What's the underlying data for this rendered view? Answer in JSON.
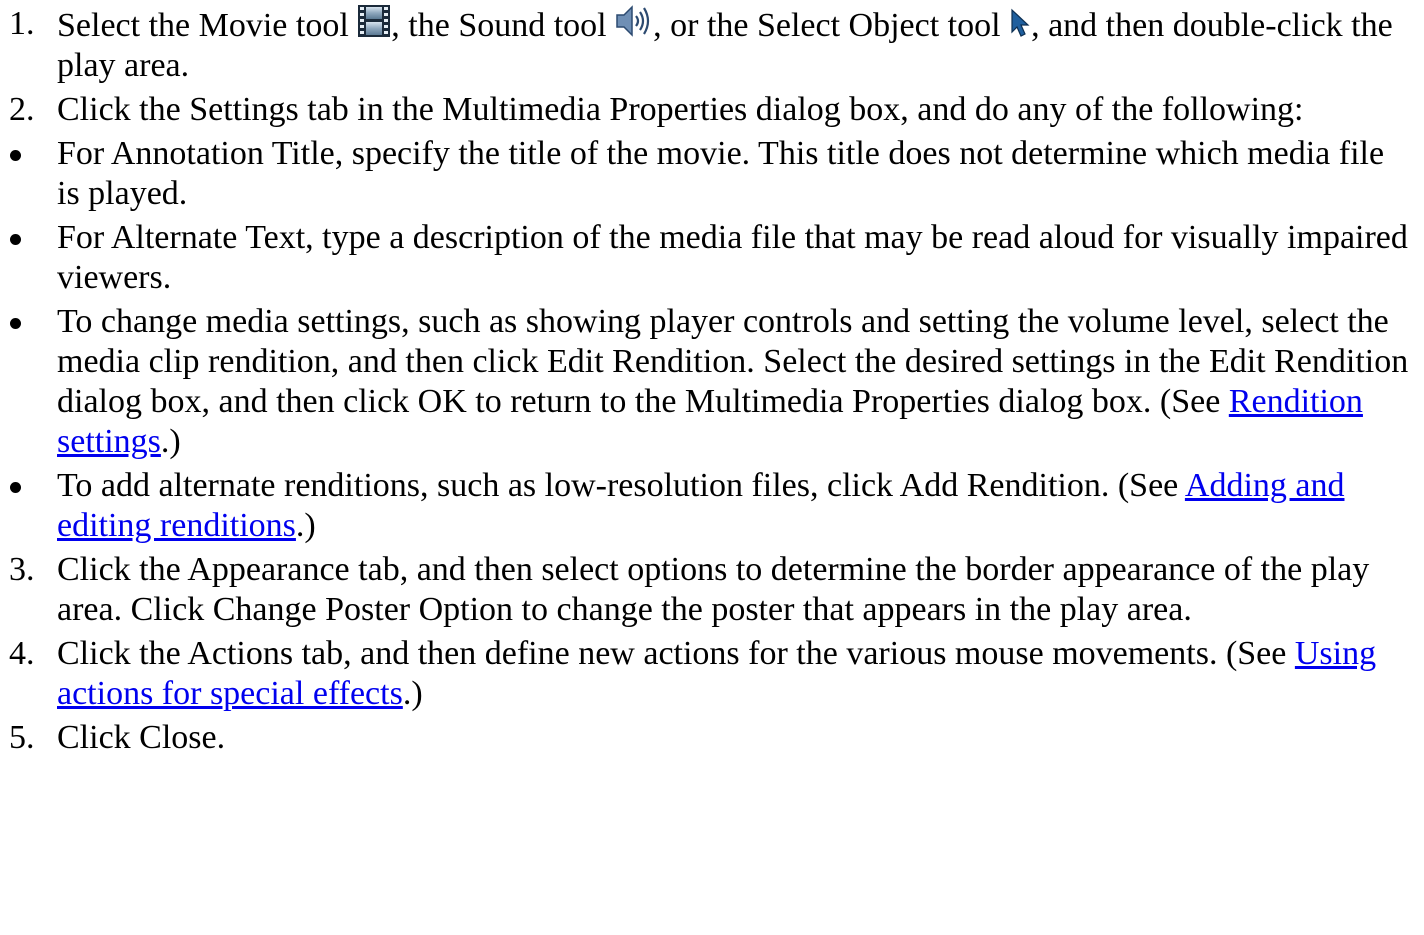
{
  "steps": [
    {
      "marker": "1.",
      "parts": {
        "a": "Select the Movie tool ",
        "b": ", the Sound tool ",
        "c": ", or the Select Object tool ",
        "d": ", and then double-click the play area."
      },
      "icons": [
        "movie-tool-icon",
        "sound-tool-icon",
        "select-object-tool-icon"
      ]
    },
    {
      "marker": "2.",
      "text": "Click the Settings tab in the Multimedia Properties dialog box, and do any of the following:"
    }
  ],
  "bullets": [
    {
      "text": "For Annotation Title, specify the title of the movie. This title does not determine which media file is played."
    },
    {
      "text": "For Alternate Text, type a description of the media file that may be read aloud for visually impaired viewers."
    },
    {
      "text_before": "To change media settings, such as showing player controls and setting the volume level, select the media clip rendition, and then click Edit Rendition. Select the desired settings in the Edit Rendition dialog box, and then click OK to return to the Multimedia Properties dialog box. (See ",
      "link": "Rendition settings",
      "text_after": ".)"
    },
    {
      "text_before": "To add alternate renditions, such as low-resolution files, click Add Rendition. (See ",
      "link": "Adding and editing renditions",
      "text_after": ".)"
    }
  ],
  "steps_after": [
    {
      "marker": "3.",
      "text": "Click the Appearance tab, and then select options to determine the border appearance of the play area. Click Change Poster Option to change the poster that appears in the play area."
    },
    {
      "marker": "4.",
      "text_before": "Click the Actions tab, and then define new actions for the various mouse movements. (See ",
      "link": "Using actions for special effects",
      "text_after": ".)"
    },
    {
      "marker": "5.",
      "text": "Click Close."
    }
  ],
  "colors": {
    "link": "#0000ee",
    "text": "#000000",
    "background": "#ffffff"
  }
}
